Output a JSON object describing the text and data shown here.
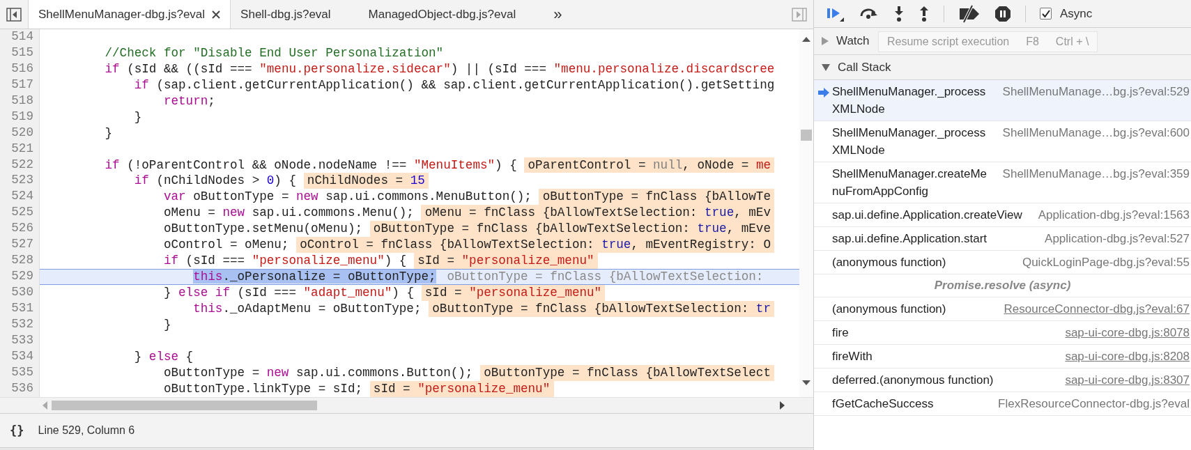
{
  "tabs": [
    {
      "label": "ShellMenuManager-dbg.js?eval",
      "selected": true
    },
    {
      "label": "Shell-dbg.js?eval",
      "selected": false
    },
    {
      "label": "ManagedObject-dbg.js?eval",
      "selected": false
    }
  ],
  "more_tabs": "»",
  "source": {
    "lines": [
      {
        "number": "514",
        "current": false
      },
      {
        "number": "515",
        "current": false,
        "code": [
          {
            "t": "        //Check for \"Disable End User Personalization\"",
            "kind": "comment"
          }
        ]
      },
      {
        "number": "516",
        "current": false,
        "code": [
          {
            "t": "        if",
            "kind": "keyword"
          },
          {
            "t": " (sId && ((sId === ",
            "kind": "plain"
          },
          {
            "t": "\"menu.personalize.sidecar\"",
            "kind": "string"
          },
          {
            "t": ") || (sId === ",
            "kind": "plain"
          },
          {
            "t": "\"menu.personalize.discardscree",
            "kind": "string"
          }
        ]
      },
      {
        "number": "517",
        "current": false,
        "code": [
          {
            "t": "            if",
            "kind": "keyword"
          },
          {
            "t": " (sap.client.getCurrentApplication() && sap.client.getCurrentApplication().getSetting",
            "kind": "plain"
          }
        ]
      },
      {
        "number": "518",
        "current": false,
        "code": [
          {
            "t": "                return",
            "kind": "keyword"
          },
          {
            "t": ";",
            "kind": "plain"
          }
        ]
      },
      {
        "number": "519",
        "current": false,
        "code": [
          {
            "t": "            }",
            "kind": "plain"
          }
        ]
      },
      {
        "number": "520",
        "current": false,
        "code": [
          {
            "t": "        }",
            "kind": "plain"
          }
        ]
      },
      {
        "number": "521",
        "current": false
      },
      {
        "number": "522",
        "current": false,
        "code": [
          {
            "t": "        if",
            "kind": "keyword"
          },
          {
            "t": " (!oParentControl && oNode.nodeName !== ",
            "kind": "plain"
          },
          {
            "t": "\"MenuItems\"",
            "kind": "string"
          },
          {
            "t": ") {",
            "kind": "plain"
          }
        ],
        "value": [
          {
            "t": "oParentControl = ",
            "kind": "plain"
          },
          {
            "t": "null",
            "kind": "literal"
          },
          {
            "t": ", oNode = ",
            "kind": "plain"
          },
          {
            "t": "me",
            "kind": "string"
          }
        ]
      },
      {
        "number": "523",
        "current": false,
        "code": [
          {
            "t": "            if",
            "kind": "keyword"
          },
          {
            "t": " (nChildNodes > ",
            "kind": "plain"
          },
          {
            "t": "0",
            "kind": "number"
          },
          {
            "t": ") {",
            "kind": "plain"
          }
        ],
        "value": [
          {
            "t": "nChildNodes = ",
            "kind": "plain"
          },
          {
            "t": "15",
            "kind": "number"
          }
        ]
      },
      {
        "number": "524",
        "current": false,
        "code": [
          {
            "t": "                var",
            "kind": "keyword"
          },
          {
            "t": " oButtonType = ",
            "kind": "plain"
          },
          {
            "t": "new",
            "kind": "keyword"
          },
          {
            "t": " sap.ui.commons.MenuButton();",
            "kind": "plain"
          }
        ],
        "value": [
          {
            "t": "oButtonType = fnClass {bAllowTe",
            "kind": "plain"
          }
        ]
      },
      {
        "number": "525",
        "current": false,
        "code": [
          {
            "t": "                oMenu = ",
            "kind": "plain"
          },
          {
            "t": "new",
            "kind": "keyword"
          },
          {
            "t": " sap.ui.commons.Menu();",
            "kind": "plain"
          }
        ],
        "value": [
          {
            "t": "oMenu = fnClass {bAllowTextSelection: ",
            "kind": "plain"
          },
          {
            "t": "true",
            "kind": "bool"
          },
          {
            "t": ", mEv",
            "kind": "plain"
          }
        ]
      },
      {
        "number": "526",
        "current": false,
        "code": [
          {
            "t": "                oButtonType.setMenu(oMenu);",
            "kind": "plain"
          }
        ],
        "value": [
          {
            "t": "oButtonType = fnClass {bAllowTextSelection: ",
            "kind": "plain"
          },
          {
            "t": "true",
            "kind": "bool"
          },
          {
            "t": ", mEve",
            "kind": "plain"
          }
        ]
      },
      {
        "number": "527",
        "current": false,
        "code": [
          {
            "t": "                oControl = oMenu;",
            "kind": "plain"
          }
        ],
        "value": [
          {
            "t": "oControl = fnClass {bAllowTextSelection: ",
            "kind": "plain"
          },
          {
            "t": "true",
            "kind": "bool"
          },
          {
            "t": ", mEventRegistry: O",
            "kind": "plain"
          }
        ]
      },
      {
        "number": "528",
        "current": false,
        "code": [
          {
            "t": "                if",
            "kind": "keyword"
          },
          {
            "t": " (sId === ",
            "kind": "plain"
          },
          {
            "t": "\"personalize_menu\"",
            "kind": "string"
          },
          {
            "t": ") {",
            "kind": "plain"
          }
        ],
        "value": [
          {
            "t": "sId = ",
            "kind": "plain"
          },
          {
            "t": "\"personalize_menu\"",
            "kind": "string"
          }
        ]
      },
      {
        "number": "529",
        "current": true,
        "code": [
          {
            "t": "                    this",
            "kind": "keyword"
          },
          {
            "t": "._oPersonalize = oButtonType;",
            "kind": "plain"
          }
        ],
        "value": [
          {
            "t": "oButtonType = fnClass {bAllowTextSelection:",
            "kind": "plain"
          }
        ]
      },
      {
        "number": "530",
        "current": false,
        "code": [
          {
            "t": "                } ",
            "kind": "plain"
          },
          {
            "t": "else if",
            "kind": "keyword"
          },
          {
            "t": " (sId === ",
            "kind": "plain"
          },
          {
            "t": "\"adapt_menu\"",
            "kind": "string"
          },
          {
            "t": ") {",
            "kind": "plain"
          }
        ],
        "value": [
          {
            "t": "sId = ",
            "kind": "plain"
          },
          {
            "t": "\"personalize_menu\"",
            "kind": "string"
          }
        ]
      },
      {
        "number": "531",
        "current": false,
        "code": [
          {
            "t": "                    this",
            "kind": "keyword"
          },
          {
            "t": "._oAdaptMenu = oButtonType;",
            "kind": "plain"
          }
        ],
        "value": [
          {
            "t": "oButtonType = fnClass {bAllowTextSelection: ",
            "kind": "plain"
          },
          {
            "t": "tr",
            "kind": "bool"
          }
        ]
      },
      {
        "number": "532",
        "current": false,
        "code": [
          {
            "t": "                }",
            "kind": "plain"
          }
        ]
      },
      {
        "number": "533",
        "current": false
      },
      {
        "number": "534",
        "current": false,
        "code": [
          {
            "t": "            } ",
            "kind": "plain"
          },
          {
            "t": "else",
            "kind": "keyword"
          },
          {
            "t": " {",
            "kind": "plain"
          }
        ]
      },
      {
        "number": "535",
        "current": false,
        "code": [
          {
            "t": "                oButtonType = ",
            "kind": "plain"
          },
          {
            "t": "new",
            "kind": "keyword"
          },
          {
            "t": " sap.ui.commons.Button();",
            "kind": "plain"
          }
        ],
        "value": [
          {
            "t": "oButtonType = fnClass {bAllowTextSelect",
            "kind": "plain"
          }
        ]
      },
      {
        "number": "536",
        "current": false,
        "code": [
          {
            "t": "                oButtonType.linkType = sId;",
            "kind": "plain"
          }
        ],
        "value": [
          {
            "t": "sId = ",
            "kind": "plain"
          },
          {
            "t": "\"personalize_menu\"",
            "kind": "string"
          }
        ]
      }
    ]
  },
  "status_bar": {
    "pretty_print": "{}",
    "position": "Line 529, Column 6"
  },
  "sidebar": {
    "async": {
      "label": "Async",
      "checked": true
    },
    "tooltip": {
      "text": "Resume script execution",
      "shortcuts": [
        "F8",
        "Ctrl + \\"
      ]
    },
    "watch": {
      "title": "Watch",
      "expanded": false
    },
    "call_stack": {
      "title": "Call Stack",
      "expanded": true,
      "frames": [
        {
          "kind": "frame",
          "name": "ShellMenuManager._processXMLNode",
          "location": "ShellMenuManage…bg.js?eval:529",
          "link": false,
          "current": true
        },
        {
          "kind": "frame",
          "name": "ShellMenuManager._processXMLNode",
          "location": "ShellMenuManage…bg.js?eval:600",
          "link": false,
          "current": false
        },
        {
          "kind": "frame",
          "name": "ShellMenuManager.createMenuFromAppConfig",
          "location": "ShellMenuManage…bg.js?eval:359",
          "link": false,
          "current": false
        },
        {
          "kind": "frame",
          "name": "sap.ui.define.Application.createView",
          "location": "Application-dbg.js?eval:1563",
          "link": false,
          "current": false
        },
        {
          "kind": "frame",
          "name": "sap.ui.define.Application.start",
          "location": "Application-dbg.js?eval:527",
          "link": false,
          "current": false
        },
        {
          "kind": "frame",
          "name": "(anonymous function)",
          "location": "QuickLoginPage-dbg.js?eval:55",
          "link": false,
          "current": false
        },
        {
          "kind": "async",
          "label": "Promise.resolve (async)"
        },
        {
          "kind": "frame",
          "name": "(anonymous function)",
          "location": "ResourceConnector-dbg.js?eval:67",
          "link": true,
          "current": false
        },
        {
          "kind": "frame",
          "name": "fire",
          "location": "sap-ui-core-dbg.js:8078",
          "link": true,
          "current": false
        },
        {
          "kind": "frame",
          "name": "fireWith",
          "location": "sap-ui-core-dbg.js:8208",
          "link": true,
          "current": false
        },
        {
          "kind": "frame",
          "name": "deferred.(anonymous function)",
          "location": "sap-ui-core-dbg.js:8307",
          "link": true,
          "current": false
        },
        {
          "kind": "frame",
          "name": "fGetCacheSuccess",
          "location": "FlexResourceConnector-dbg.js?eval",
          "link": false,
          "current": false
        }
      ]
    }
  }
}
